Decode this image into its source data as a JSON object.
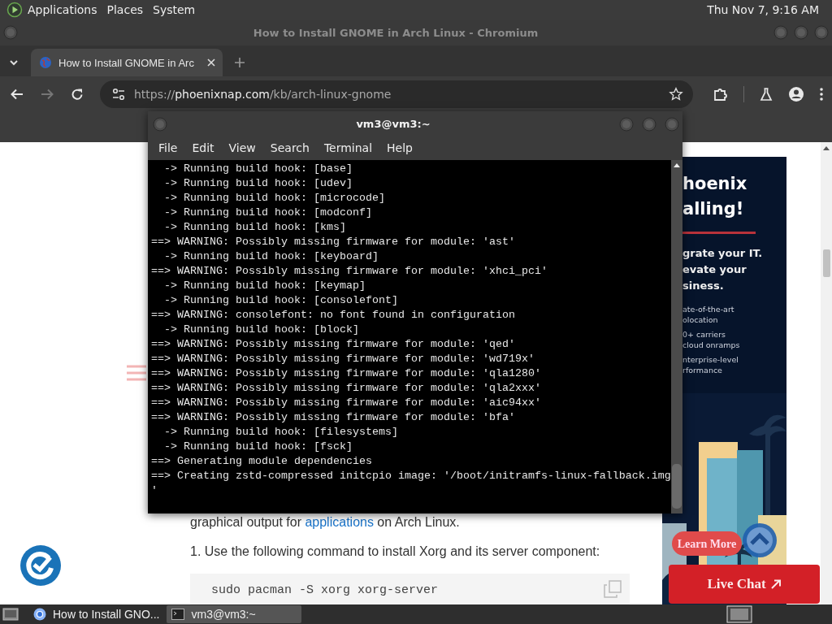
{
  "top_panel": {
    "menus": [
      "Applications",
      "Places",
      "System"
    ],
    "clock": "Thu Nov 7, 9:16 AM"
  },
  "browser": {
    "title": "How to Install GNOME in Arch Linux - Chromium",
    "tabs": [
      {
        "label": "How to Install GNOME in Arc",
        "selected": true
      }
    ],
    "forward_disabled": true,
    "url": {
      "scheme": "https://",
      "host": "phoenixnap.com",
      "path": "/kb/arch-linux-gnome"
    },
    "page": {
      "paragraph": {
        "before": "graphical output for ",
        "link": "applications",
        "after": " on Arch Linux."
      },
      "step": "1. Use the following command to install Xorg and its server component:",
      "code": "sudo pacman -S xorg xorg-server",
      "ad": {
        "heading": [
          "hoenix",
          "alling!"
        ],
        "subheading": [
          "grate your IT.",
          "evate your",
          "siness."
        ],
        "bullets": [
          [
            "ate-of-the-art",
            "olocation"
          ],
          [
            "0+ carriers",
            "cloud onramps"
          ],
          [
            "nterprise-level",
            "rformance"
          ]
        ],
        "button": "Learn More"
      },
      "live_chat": "Live Chat"
    }
  },
  "terminal": {
    "title": "vm3@vm3:~",
    "menu": [
      "File",
      "Edit",
      "View",
      "Search",
      "Terminal",
      "Help"
    ],
    "lines": [
      "  -> Running build hook: [base]",
      "  -> Running build hook: [udev]",
      "  -> Running build hook: [microcode]",
      "  -> Running build hook: [modconf]",
      "  -> Running build hook: [kms]",
      "==> WARNING: Possibly missing firmware for module: 'ast'",
      "  -> Running build hook: [keyboard]",
      "==> WARNING: Possibly missing firmware for module: 'xhci_pci'",
      "  -> Running build hook: [keymap]",
      "  -> Running build hook: [consolefont]",
      "==> WARNING: consolefont: no font found in configuration",
      "  -> Running build hook: [block]",
      "==> WARNING: Possibly missing firmware for module: 'qed'",
      "==> WARNING: Possibly missing firmware for module: 'wd719x'",
      "==> WARNING: Possibly missing firmware for module: 'qla1280'",
      "==> WARNING: Possibly missing firmware for module: 'qla2xxx'",
      "==> WARNING: Possibly missing firmware for module: 'aic94xx'",
      "==> WARNING: Possibly missing firmware for module: 'bfa'",
      "  -> Running build hook: [filesystems]",
      "  -> Running build hook: [fsck]",
      "==> Generating module dependencies",
      "==> Creating zstd-compressed initcpio image: '/boot/initramfs-linux-fallback.img",
      "'"
    ]
  },
  "taskbar": {
    "tasks": [
      {
        "kind": "browser",
        "label": "How to Install GNO...",
        "selected": false
      },
      {
        "kind": "terminal",
        "label": "vm3@vm3:~",
        "selected": true
      }
    ]
  }
}
